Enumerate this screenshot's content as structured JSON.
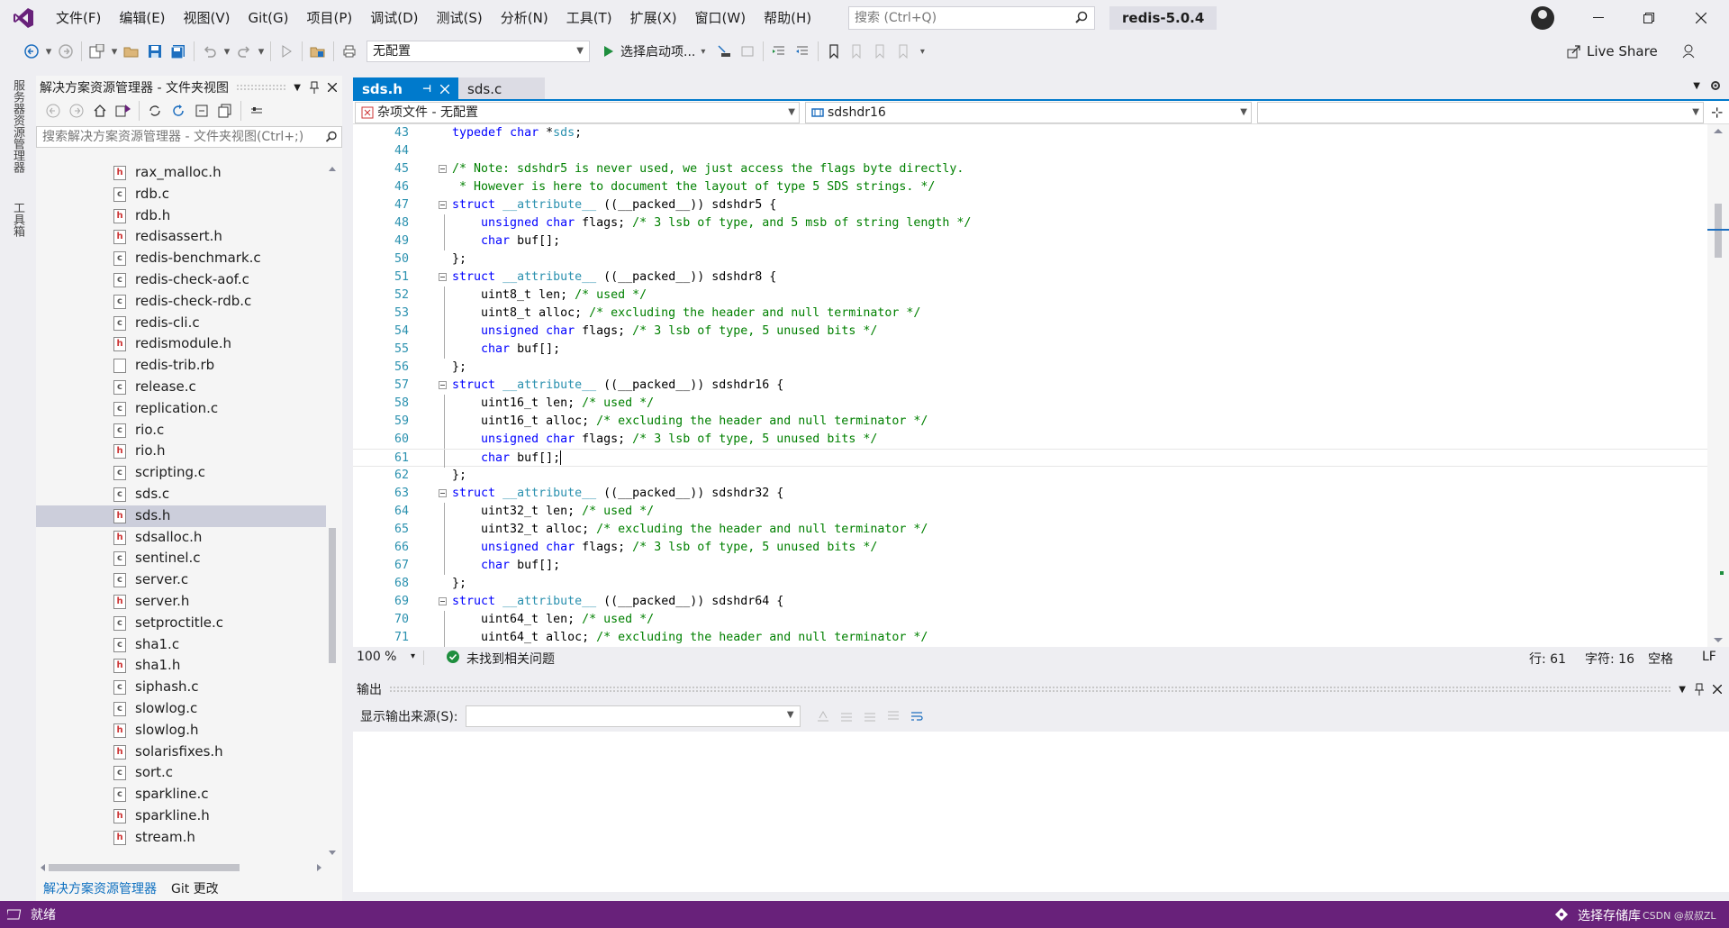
{
  "menubar": {
    "items": [
      "文件(F)",
      "编辑(E)",
      "视图(V)",
      "Git(G)",
      "项目(P)",
      "调试(D)",
      "测试(S)",
      "分析(N)",
      "工具(T)",
      "扩展(X)",
      "窗口(W)",
      "帮助(H)"
    ],
    "search_placeholder": "搜索 (Ctrl+Q)",
    "solution_name": "redis-5.0.4"
  },
  "toolbar": {
    "config_value": "无配置",
    "start_label": "选择启动项...",
    "live_share": "Live Share"
  },
  "side_tabs": {
    "server_explorer": "服务器资源管理器",
    "toolbox": "工具箱"
  },
  "solution_explorer": {
    "title": "解决方案资源管理器 - 文件夹视图",
    "search_placeholder": "搜索解决方案资源管理器 - 文件夹视图(Ctrl+;)",
    "files": [
      {
        "name": "rax_malloc.h",
        "type": "h"
      },
      {
        "name": "rdb.c",
        "type": "c"
      },
      {
        "name": "rdb.h",
        "type": "h"
      },
      {
        "name": "redisassert.h",
        "type": "h"
      },
      {
        "name": "redis-benchmark.c",
        "type": "c"
      },
      {
        "name": "redis-check-aof.c",
        "type": "c"
      },
      {
        "name": "redis-check-rdb.c",
        "type": "c"
      },
      {
        "name": "redis-cli.c",
        "type": "c"
      },
      {
        "name": "redismodule.h",
        "type": "h"
      },
      {
        "name": "redis-trib.rb",
        "type": "rb"
      },
      {
        "name": "release.c",
        "type": "c"
      },
      {
        "name": "replication.c",
        "type": "c"
      },
      {
        "name": "rio.c",
        "type": "c"
      },
      {
        "name": "rio.h",
        "type": "h"
      },
      {
        "name": "scripting.c",
        "type": "c"
      },
      {
        "name": "sds.c",
        "type": "c"
      },
      {
        "name": "sds.h",
        "type": "h",
        "selected": true
      },
      {
        "name": "sdsalloc.h",
        "type": "h"
      },
      {
        "name": "sentinel.c",
        "type": "c"
      },
      {
        "name": "server.c",
        "type": "c"
      },
      {
        "name": "server.h",
        "type": "h"
      },
      {
        "name": "setproctitle.c",
        "type": "c"
      },
      {
        "name": "sha1.c",
        "type": "c"
      },
      {
        "name": "sha1.h",
        "type": "h"
      },
      {
        "name": "siphash.c",
        "type": "c"
      },
      {
        "name": "slowlog.c",
        "type": "c"
      },
      {
        "name": "slowlog.h",
        "type": "h"
      },
      {
        "name": "solarisfixes.h",
        "type": "h"
      },
      {
        "name": "sort.c",
        "type": "c"
      },
      {
        "name": "sparkline.c",
        "type": "c"
      },
      {
        "name": "sparkline.h",
        "type": "h"
      },
      {
        "name": "stream.h",
        "type": "h"
      }
    ],
    "bottom_tabs": [
      "解决方案资源管理器",
      "Git 更改"
    ]
  },
  "editor": {
    "tabs": [
      {
        "label": "sds.h",
        "active": true
      },
      {
        "label": "sds.c",
        "active": false
      }
    ],
    "nav_scope": "杂项文件 - 无配置",
    "nav_member": "sdshdr16",
    "nav_third": "",
    "lines": [
      {
        "n": "43",
        "html": "<span class=\"kw\">typedef</span> <span class=\"kw\">char</span> *<span class=\"ty\">sds</span>;"
      },
      {
        "n": "44",
        "html": ""
      },
      {
        "n": "45",
        "html": "<span class=\"cm\">/* Note: sdshdr5 is never used, we just access the flags byte directly.</span>",
        "fold": true
      },
      {
        "n": "46",
        "html": "<span class=\"cm\"> * However is here to document the layout of type 5 SDS strings. */</span>"
      },
      {
        "n": "47",
        "html": "<span class=\"kw\">struct</span> <span class=\"ty\">__attribute__</span> ((__packed__)) sdshdr5 {",
        "fold": true
      },
      {
        "n": "48",
        "html": "    <span class=\"kw\">unsigned</span> <span class=\"kw\">char</span> flags; <span class=\"cm\">/* 3 lsb of type, and 5 msb of string length */</span>",
        "guide": true
      },
      {
        "n": "49",
        "html": "    <span class=\"kw\">char</span> buf[];",
        "guide": true
      },
      {
        "n": "50",
        "html": "};"
      },
      {
        "n": "51",
        "html": "<span class=\"kw\">struct</span> <span class=\"ty\">__attribute__</span> ((__packed__)) sdshdr8 {",
        "fold": true
      },
      {
        "n": "52",
        "html": "    uint8_t len; <span class=\"cm\">/* used */</span>",
        "guide": true
      },
      {
        "n": "53",
        "html": "    uint8_t alloc; <span class=\"cm\">/* excluding the header and null terminator */</span>",
        "guide": true
      },
      {
        "n": "54",
        "html": "    <span class=\"kw\">unsigned</span> <span class=\"kw\">char</span> flags; <span class=\"cm\">/* 3 lsb of type, 5 unused bits */</span>",
        "guide": true
      },
      {
        "n": "55",
        "html": "    <span class=\"kw\">char</span> buf[];",
        "guide": true
      },
      {
        "n": "56",
        "html": "};"
      },
      {
        "n": "57",
        "html": "<span class=\"kw\">struct</span> <span class=\"ty\">__attribute__</span> ((__packed__)) sdshdr16 {",
        "fold": true
      },
      {
        "n": "58",
        "html": "    uint16_t len; <span class=\"cm\">/* used */</span>",
        "guide": true
      },
      {
        "n": "59",
        "html": "    uint16_t alloc; <span class=\"cm\">/* excluding the header and null terminator */</span>",
        "guide": true
      },
      {
        "n": "60",
        "html": "    <span class=\"kw\">unsigned</span> <span class=\"kw\">char</span> flags; <span class=\"cm\">/* 3 lsb of type, 5 unused bits */</span>",
        "guide": true
      },
      {
        "n": "61",
        "html": "    <span class=\"kw\">char</span> buf[];<span class=\"caret\"></span>",
        "guide": true,
        "current": true
      },
      {
        "n": "62",
        "html": "};"
      },
      {
        "n": "63",
        "html": "<span class=\"kw\">struct</span> <span class=\"ty\">__attribute__</span> ((__packed__)) sdshdr32 {",
        "fold": true
      },
      {
        "n": "64",
        "html": "    uint32_t len; <span class=\"cm\">/* used */</span>",
        "guide": true
      },
      {
        "n": "65",
        "html": "    uint32_t alloc; <span class=\"cm\">/* excluding the header and null terminator */</span>",
        "guide": true
      },
      {
        "n": "66",
        "html": "    <span class=\"kw\">unsigned</span> <span class=\"kw\">char</span> flags; <span class=\"cm\">/* 3 lsb of type, 5 unused bits */</span>",
        "guide": true
      },
      {
        "n": "67",
        "html": "    <span class=\"kw\">char</span> buf[];",
        "guide": true
      },
      {
        "n": "68",
        "html": "};"
      },
      {
        "n": "69",
        "html": "<span class=\"kw\">struct</span> <span class=\"ty\">__attribute__</span> ((__packed__)) sdshdr64 {",
        "fold": true
      },
      {
        "n": "70",
        "html": "    uint64_t len; <span class=\"cm\">/* used */</span>",
        "guide": true
      },
      {
        "n": "71",
        "html": "    uint64_t alloc; <span class=\"cm\">/* excluding the header and null terminator */</span>",
        "guide": true
      }
    ]
  },
  "editor_status": {
    "zoom": "100 %",
    "issues": "未找到相关问题",
    "line": "行: 61",
    "char": "字符: 16",
    "whitespace": "空格",
    "eol": "LF"
  },
  "output_panel": {
    "title": "输出",
    "source_label": "显示输出来源(S):",
    "source_value": ""
  },
  "statusbar": {
    "ready": "就绪",
    "repo": "选择存储库",
    "watermark": "CSDN @叔叔ZL"
  },
  "colors": {
    "accent": "#007acc",
    "statusbar": "#68217a",
    "keyword": "#0000ff",
    "comment": "#008000",
    "type": "#2b91af"
  }
}
